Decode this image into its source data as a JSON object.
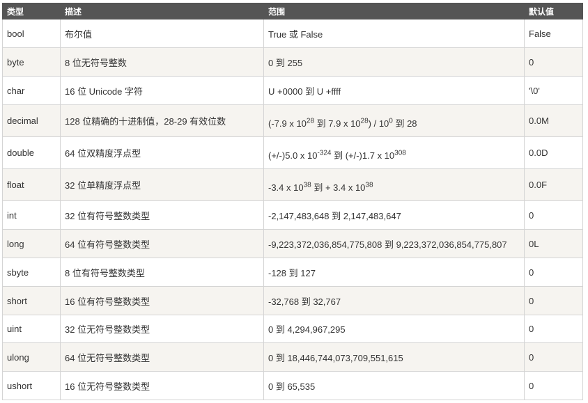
{
  "headers": {
    "type": "类型",
    "desc": "描述",
    "range": "范围",
    "default": "默认值"
  },
  "rows": [
    {
      "type": "bool",
      "desc": "布尔值",
      "range": "True 或 False",
      "default": "False"
    },
    {
      "type": "byte",
      "desc": "8 位无符号整数",
      "range": "0 到 255",
      "default": "0"
    },
    {
      "type": "char",
      "desc": "16 位 Unicode 字符",
      "range": "U +0000 到 U +ffff",
      "default": "'\\0'"
    },
    {
      "type": "decimal",
      "desc": "128 位精确的十进制值，28-29 有效位数",
      "range_parts": {
        "a": "(-7.9 x 10",
        "a_sup": "28",
        "b": " 到 7.9 x 10",
        "b_sup": "28",
        "c": ") / 10",
        "c_sup": "0",
        "d": " 到 28"
      },
      "default": "0.0M"
    },
    {
      "type": "double",
      "desc": "64 位双精度浮点型",
      "range_parts": {
        "a": "(+/-)5.0 x 10",
        "a_sup": "-324",
        "b": " 到 (+/-)1.7 x 10",
        "b_sup": "308"
      },
      "default": "0.0D"
    },
    {
      "type": "float",
      "desc": "32 位单精度浮点型",
      "range_parts": {
        "a": "-3.4 x 10",
        "a_sup": "38",
        "b": " 到 + 3.4 x 10",
        "b_sup": "38"
      },
      "default": "0.0F"
    },
    {
      "type": "int",
      "desc": "32 位有符号整数类型",
      "range": "-2,147,483,648 到 2,147,483,647",
      "default": "0"
    },
    {
      "type": "long",
      "desc": "64 位有符号整数类型",
      "range": "-9,223,372,036,854,775,808 到 9,223,372,036,854,775,807",
      "default": "0L"
    },
    {
      "type": "sbyte",
      "desc": "8 位有符号整数类型",
      "range": "-128 到 127",
      "default": "0"
    },
    {
      "type": "short",
      "desc": "16 位有符号整数类型",
      "range": "-32,768 到 32,767",
      "default": "0"
    },
    {
      "type": "uint",
      "desc": "32 位无符号整数类型",
      "range": "0 到 4,294,967,295",
      "default": "0"
    },
    {
      "type": "ulong",
      "desc": "64 位无符号整数类型",
      "range": "0 到 18,446,744,073,709,551,615",
      "default": "0"
    },
    {
      "type": "ushort",
      "desc": "16 位无符号整数类型",
      "range": "0 到 65,535",
      "default": "0"
    }
  ]
}
